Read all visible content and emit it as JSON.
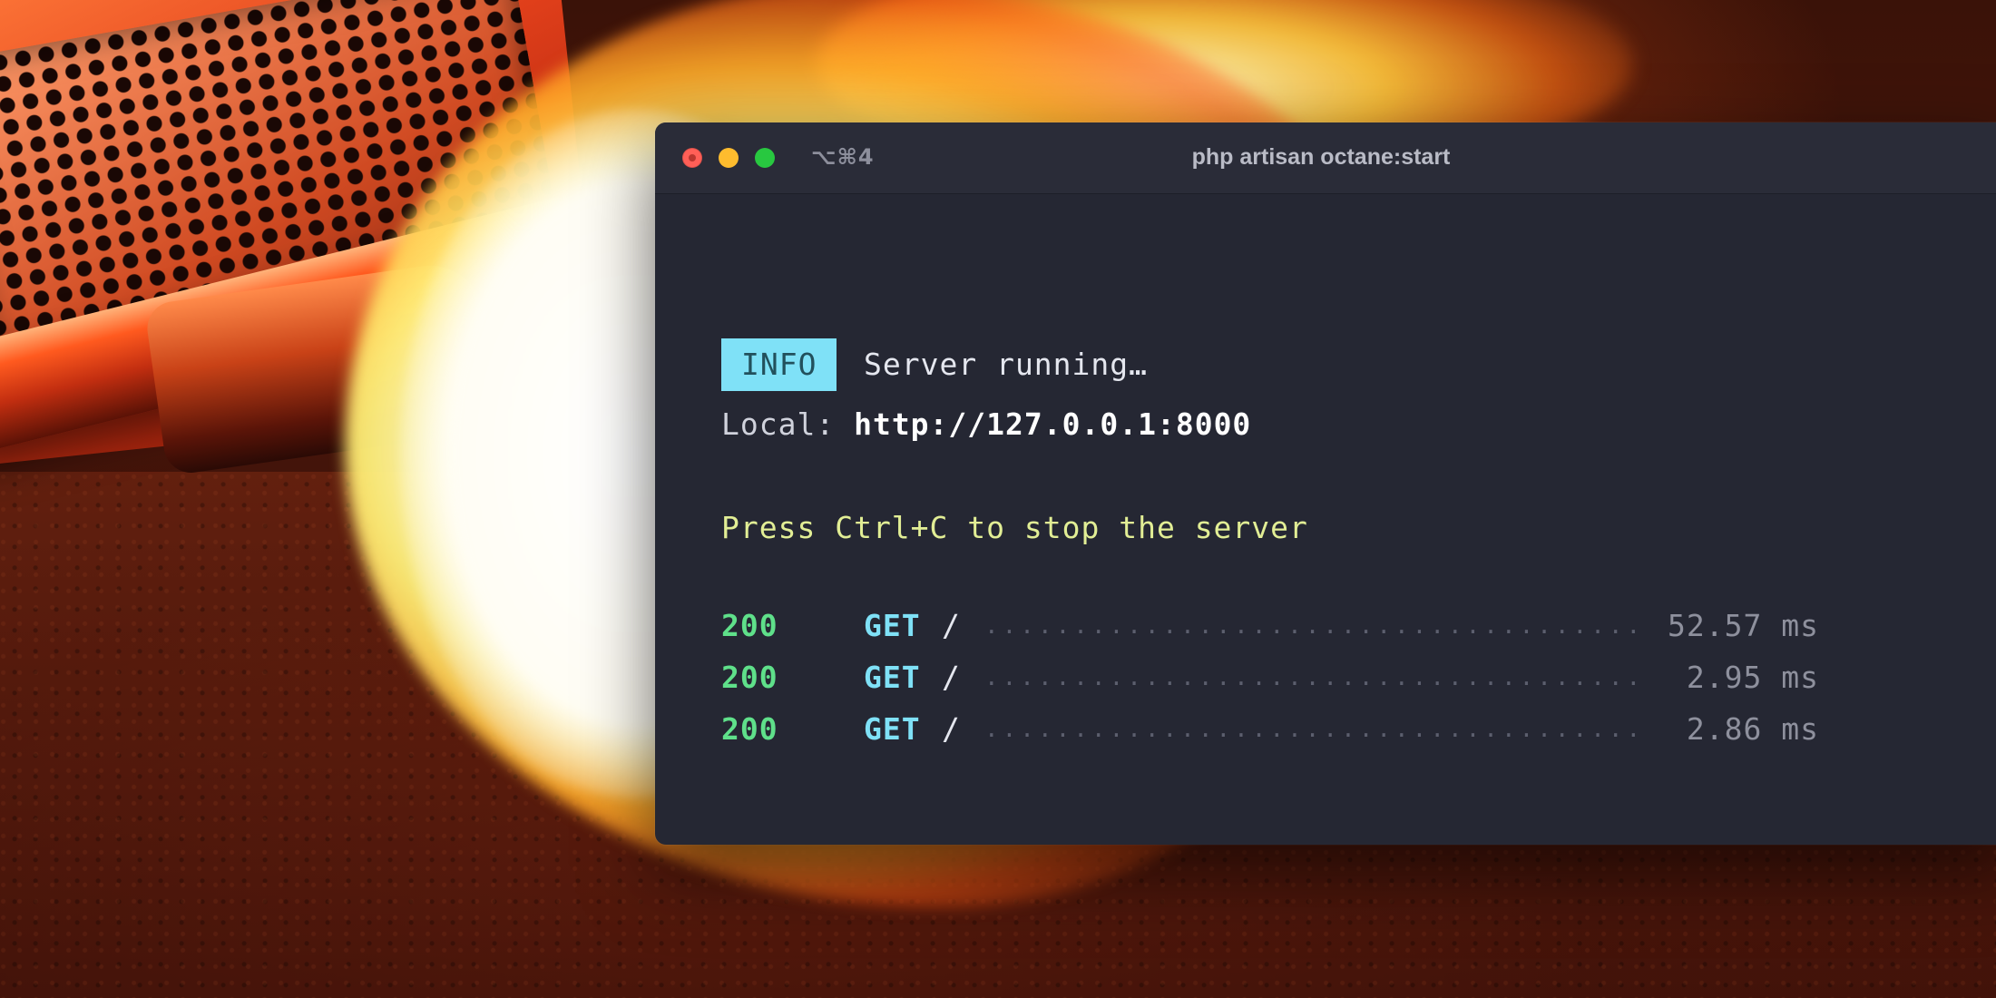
{
  "window": {
    "shortcut": "⌥⌘4",
    "title": "php artisan octane:start"
  },
  "output": {
    "info_badge": "INFO",
    "info_message": "Server running…",
    "local_label": "Local: ",
    "local_url": "http://127.0.0.1:8000",
    "stop_hint": "Press Ctrl+C to stop the server",
    "requests": [
      {
        "status": "200",
        "method": "GET",
        "path": "/",
        "duration": "52.57 ms"
      },
      {
        "status": "200",
        "method": "GET",
        "path": "/",
        "duration": "2.95 ms"
      },
      {
        "status": "200",
        "method": "GET",
        "path": "/",
        "duration": "2.86 ms"
      }
    ]
  },
  "colors": {
    "terminal_bg": "#252733",
    "info_badge_bg": "#7fe1f7",
    "status_ok": "#5fe08a",
    "method": "#7fe1f7",
    "hint": "#e2ee95",
    "close": "#ff5f57",
    "minimize": "#febc2e",
    "zoom": "#28c840"
  }
}
